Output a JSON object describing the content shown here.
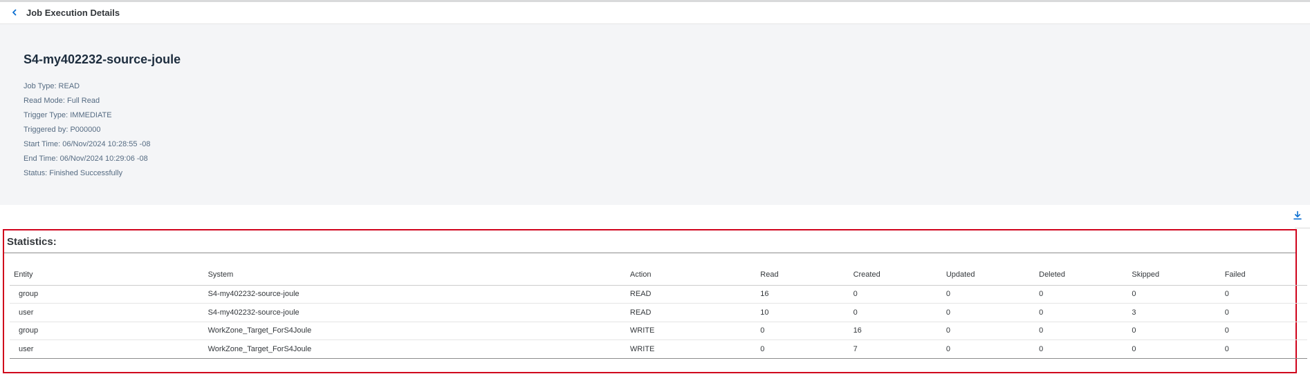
{
  "nav": {
    "title": "Job Execution Details",
    "back_icon": "chevron-left-icon"
  },
  "header": {
    "title": "S4-my402232-source-joule",
    "attributes": [
      "Job Type: READ",
      "Read Mode: Full Read",
      "Trigger Type: IMMEDIATE",
      "Triggered by: P000000",
      "Start Time: 06/Nov/2024 10:28:55 -08",
      "End Time: 06/Nov/2024 10:29:06 -08",
      "Status: Finished Successfully"
    ]
  },
  "toolbar": {
    "download_icon": "download-icon"
  },
  "statistics": {
    "title": "Statistics:",
    "columns": [
      "Entity",
      "System",
      "Action",
      "Read",
      "Created",
      "Updated",
      "Deleted",
      "Skipped",
      "Failed"
    ],
    "rows": [
      [
        "group",
        "S4-my402232-source-joule",
        "READ",
        "16",
        "0",
        "0",
        "0",
        "0",
        "0"
      ],
      [
        "user",
        "S4-my402232-source-joule",
        "READ",
        "10",
        "0",
        "0",
        "0",
        "3",
        "0"
      ],
      [
        "group",
        "WorkZone_Target_ForS4Joule",
        "WRITE",
        "0",
        "16",
        "0",
        "0",
        "0",
        "0"
      ],
      [
        "user",
        "WorkZone_Target_ForS4Joule",
        "WRITE",
        "0",
        "7",
        "0",
        "0",
        "0",
        "0"
      ]
    ]
  },
  "colors": {
    "highlight_border": "#d0021b",
    "accent": "#0a6ed1",
    "header_bg": "#f4f5f7"
  }
}
